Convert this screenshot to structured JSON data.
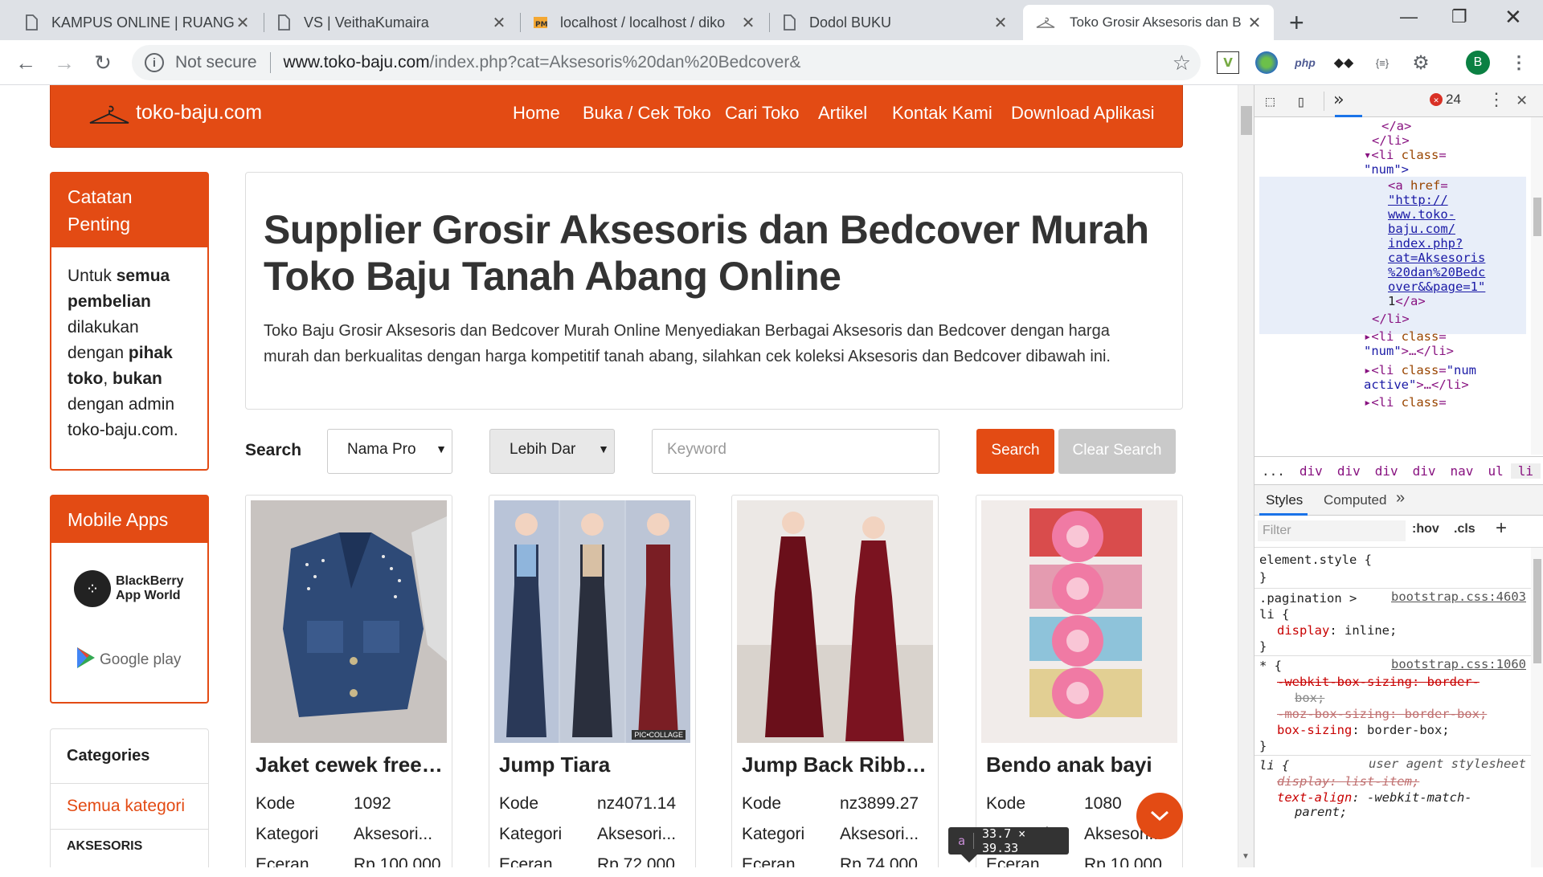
{
  "tabs": [
    {
      "title": "KAMPUS ONLINE | RUANG",
      "icon": "document-icon"
    },
    {
      "title": "VS | VeithaKumaira",
      "icon": "document-icon"
    },
    {
      "title": "localhost / localhost / diko",
      "icon": "phpmyadmin-icon"
    },
    {
      "title": "Dodol BUKU",
      "icon": "document-icon"
    },
    {
      "title": "Toko Grosir Aksesoris dan B",
      "icon": "hanger-icon"
    }
  ],
  "new_tab": "+",
  "omnibox": {
    "security": "Not secure",
    "url_host": "www.toko-baju.com",
    "url_path": "/index.php?cat=Aksesoris%20dan%20Bedcover&"
  },
  "profile_initial": "B",
  "site": {
    "logo_text": "toko-baju.com",
    "nav": [
      "Home",
      "Buka / Cek Toko",
      "Cari Toko",
      "Artikel",
      "Kontak Kami",
      "Download Aplikasi"
    ]
  },
  "sidebar": {
    "notes_title_1": "Catatan",
    "notes_title_2": "Penting",
    "notes": [
      {
        "t": "Untuk ",
        "b": false
      },
      {
        "t": "semua pembelian",
        "b": true
      },
      {
        "t": " dilakukan dengan ",
        "b": false
      },
      {
        "t": "pihak toko",
        "b": true
      },
      {
        "t": ", ",
        "b": false
      },
      {
        "t": "bukan",
        "b": true
      },
      {
        "t": " dengan admin toko-baju.com.",
        "b": false
      }
    ],
    "mobile_title": "Mobile Apps",
    "blackberry_1": "BlackBerry",
    "blackberry_2": "App World",
    "google_play": "Google play",
    "categories_title": "Categories",
    "category_all": "Semua kategori",
    "category_next": "AKSESORIS"
  },
  "hero": {
    "title_line1": "Supplier Grosir Aksesoris dan Bedcover Murah",
    "title_line2": "Toko Baju Tanah Abang Online",
    "desc_line1": "Toko Baju Grosir Aksesoris dan Bedcover Murah Online Menyediakan Berbagai Aksesoris dan Bedcover dengan harga",
    "desc_line2": "murah dan berkualitas dengan harga kompetitif tanah abang, silahkan cek koleksi Aksesoris dan Bedcover dibawah ini."
  },
  "search": {
    "label": "Search",
    "select1": "Nama Pro",
    "select2": "Lebih Dar",
    "keyword_placeholder": "Keyword",
    "search_button": "Search",
    "clear_button": "Clear Search"
  },
  "product_labels": {
    "kode": "Kode",
    "kategori": "Kategori",
    "eceran": "Eceran"
  },
  "products": [
    {
      "name": "Jaket cewek free s...",
      "kode": "1092",
      "kategori": "Aksesori...",
      "eceran": "Rp 100.000"
    },
    {
      "name": "Jump Tiara",
      "kode": "nz4071.14",
      "kategori": "Aksesori...",
      "eceran": "Rp 72.000"
    },
    {
      "name": "Jump Back Ribbo...",
      "kode": "nz3899.27",
      "kategori": "Aksesori...",
      "eceran": "Rp 74.000"
    },
    {
      "name": "Bendo anak bayi",
      "kode": "1080",
      "kategori": "Aksesori...",
      "eceran": "Rp 10.000"
    }
  ],
  "collage_label": "PIC•COLLAGE",
  "tooltip": {
    "tag": "a",
    "size": "33.7 × 39.33"
  },
  "devtools": {
    "error_count": "24",
    "breadcrumb": [
      "...",
      "div",
      "div",
      "div",
      "div",
      "nav",
      "ul",
      "li"
    ],
    "tabs": [
      "Styles",
      "Computed"
    ],
    "filter_placeholder": "Filter",
    "hov": ":hov",
    "cls": ".cls",
    "dom": {
      "l1": "</a>",
      "l2": "</li>",
      "l3_tag": "<li ",
      "l3_attr": "class",
      "l3_eq": "=",
      "l4": "\"num\">",
      "a_open": "<a ",
      "a_attr": "href",
      "a_eq": "=",
      "href_1": "\"http://",
      "href_2": "www.toko-",
      "href_3": "baju.com/",
      "href_4": "index.php?",
      "href_5": "cat=Aksesoris",
      "href_6": "%20dan%20Bedc",
      "href_7": "over&&page=1\"",
      "a_text": "1",
      "a_close": "</a>",
      "li_close": "</li>",
      "li2_a": "<li ",
      "li2_b": "class",
      "li2_c": "=",
      "li2_d": "\"num\"",
      "li2_e": ">…</li>",
      "li3_a": "<li ",
      "li3_b": "class",
      "li3_c": "=",
      "li3_d": "\"num",
      "li3_e": "active\"",
      "li3_f": ">…</li>",
      "li4_a": "<li ",
      "li4_b": "class",
      "li4_c": "="
    },
    "styles": {
      "element_style": "element.style {",
      "close": "}",
      "rule1_sel1": ".pagination >",
      "rule1_sel2": "li {",
      "rule1_src": "bootstrap.css:4603",
      "rule1_prop": "display",
      "rule1_val": ": inline;",
      "rule2_sel": "* {",
      "rule2_src": "bootstrap.css:1060",
      "rule2_p1a": "-webkit-box-sizing: border-",
      "rule2_p1b": "box;",
      "rule2_p2": "-moz-box-sizing: border-box;",
      "rule2_p3": "box-sizing",
      "rule2_p3v": ": border-box;",
      "rule3_sel": "li {",
      "rule3_src": "user agent stylesheet",
      "rule3_p1": "display: list-item;",
      "rule3_p2": "text-align",
      "rule3_p2v": ": -webkit-match-",
      "rule3_p2c": "parent;"
    }
  },
  "colors": {
    "brand": "#e34b14",
    "clear_button": "#c9c9c9"
  }
}
